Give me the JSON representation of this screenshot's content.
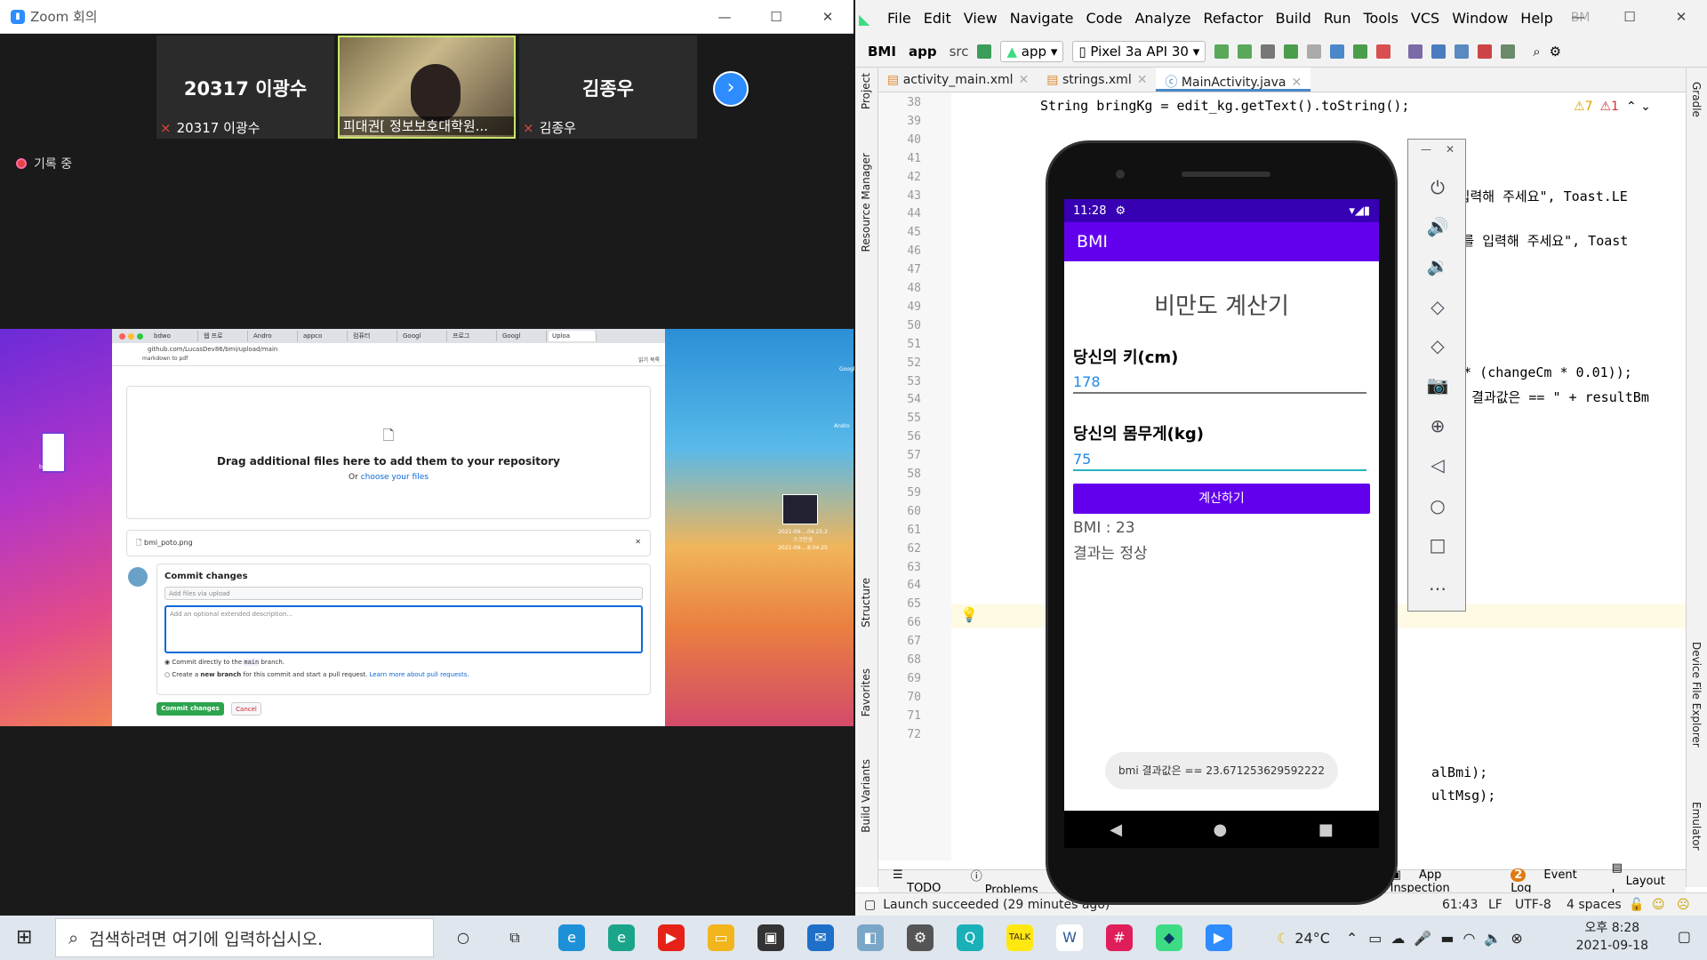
{
  "zoom": {
    "title": "Zoom 회의",
    "participants": [
      {
        "name": "20317 이광수",
        "label": "20317 이광수"
      },
      {
        "name": "",
        "label": "피대권[ 정보보호대학원..."
      },
      {
        "name": "김종우",
        "label": "김종우"
      }
    ],
    "recording": "기록 중"
  },
  "browser": {
    "tabs": [
      "bdwo",
      "웹 프로",
      "Andro",
      "appco",
      "컴퓨터",
      "Googl",
      "프로그",
      "Googl",
      "Uploa"
    ],
    "url": "github.com/LucasDev86/bmi/upload/main",
    "bookmark": "markdown to pdf",
    "bookmark_right": "읽기 목록",
    "drop_heading": "Drag additional files here to add them to your repository",
    "drop_sub_prefix": "Or ",
    "drop_sub_link": "choose your files",
    "file": "bmi_poto.png",
    "commit_title": "Commit changes",
    "commit_summary_ph": "Add files via upload",
    "commit_desc_ph": "Add an optional extended description...",
    "opt1_prefix": "Commit directly to the",
    "opt1_branch": "main",
    "opt1_suffix": "branch.",
    "opt2_prefix": "Create a ",
    "opt2_bold": "new branch",
    "opt2_suffix": " for this commit and start a pull request. ",
    "opt2_link": "Learn more about pull requests.",
    "commit_btn": "Commit changes",
    "cancel_btn": "Cancel"
  },
  "desktop": {
    "icon_label": "bmi_poto",
    "image_caption": "2021-09-...04.25.2\n스크린샷\n2021-09-...8.04.25",
    "right_label1": "Googl",
    "right_label2": "Andro"
  },
  "ide": {
    "menu": [
      "File",
      "Edit",
      "View",
      "Navigate",
      "Code",
      "Analyze",
      "Refactor",
      "Build",
      "Run",
      "Tools",
      "VCS",
      "Window",
      "Help"
    ],
    "project_short": "BM",
    "crumbs": [
      "BMI",
      "app",
      "src"
    ],
    "run_config": "app",
    "device": "Pixel 3a API 30",
    "tabs": [
      "activity_main.xml",
      "strings.xml",
      "MainActivity.java"
    ],
    "warnings": "7",
    "errors": "1",
    "lines": [
      "38",
      "39",
      "40",
      "41",
      "42",
      "43",
      "44",
      "45",
      "46",
      "47",
      "48",
      "49",
      "50",
      "51",
      "52",
      "53",
      "54",
      "55",
      "56",
      "57",
      "58",
      "59",
      "60",
      "61",
      "62",
      "63",
      "64",
      "65",
      "66",
      "67",
      "68",
      "69",
      "70",
      "71",
      "72"
    ],
    "code": {
      "l38": "String bringKg = edit_kg.getText().toString();",
      "l42": "\"키를 입력해 주세요\", Toast.LE",
      "l44": "\"몸무게를 입력해 주세요\", Toast",
      "l50": "01) * (changeCm * 0.01));",
      "l51": "\"bmi 결과값은 == \" + resultBm",
      "l68": "alBmi);",
      "l69": "ultMsg);"
    },
    "left_tools": [
      "Project",
      "Resource Manager",
      "Structure",
      "Favorites",
      "Build Variants"
    ],
    "right_tools": [
      "Gradle",
      "Device File Explorer",
      "Emulator"
    ],
    "bottom_tools": [
      "TODO",
      "Problems",
      "App Inspection",
      "Event Log",
      "Layout I"
    ],
    "event_count": "2",
    "status": "Launch succeeded (29 minutes ago)",
    "status_right": [
      "61:43",
      "LF",
      "UTF-8",
      "4 spaces"
    ]
  },
  "app": {
    "time": "11:28",
    "appname": "BMI",
    "title": "비만도 계산기",
    "height_label": "당신의 키(cm)",
    "height_val": "178",
    "weight_label": "당신의 몸무게(kg)",
    "weight_val": "75",
    "button": "계산하기",
    "bmi": "BMI : 23",
    "result": "결과는 정상",
    "toast": "bmi 결과값은 == 23.671253629592222"
  },
  "taskbar": {
    "search": "검색하려면 여기에 입력하십시오.",
    "temp": "24°C",
    "time": "오후 8:28",
    "date": "2021-09-18"
  }
}
